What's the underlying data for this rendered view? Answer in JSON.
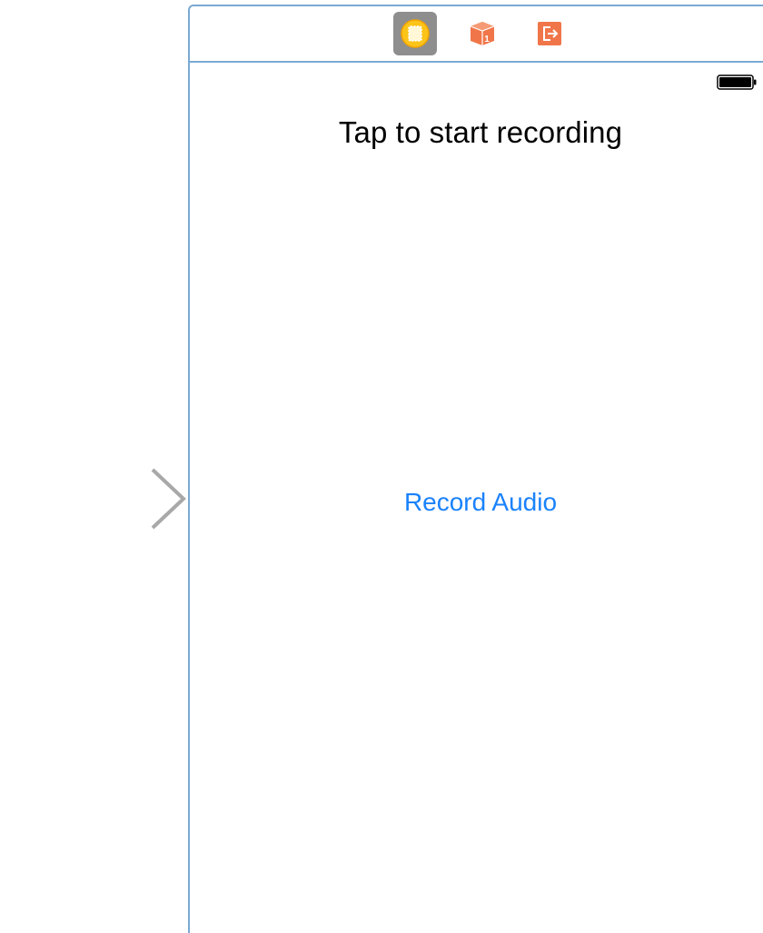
{
  "scene": {
    "dock": {
      "items": [
        {
          "name": "view-controller-icon",
          "selected": true
        },
        {
          "name": "first-responder-icon",
          "badge": "1"
        },
        {
          "name": "exit-icon"
        }
      ]
    },
    "status_bar": {
      "battery": "battery-full-icon"
    },
    "label_text": "Tap to start recording",
    "button_label": "Record Audio"
  },
  "colors": {
    "frame_border": "#7aa9d4",
    "button_tint": "#1a82fb",
    "dock_icon_orange": "#f0764a",
    "view_controller_yellow": "#fcc419",
    "selected_bg": "#8e8e8e"
  }
}
